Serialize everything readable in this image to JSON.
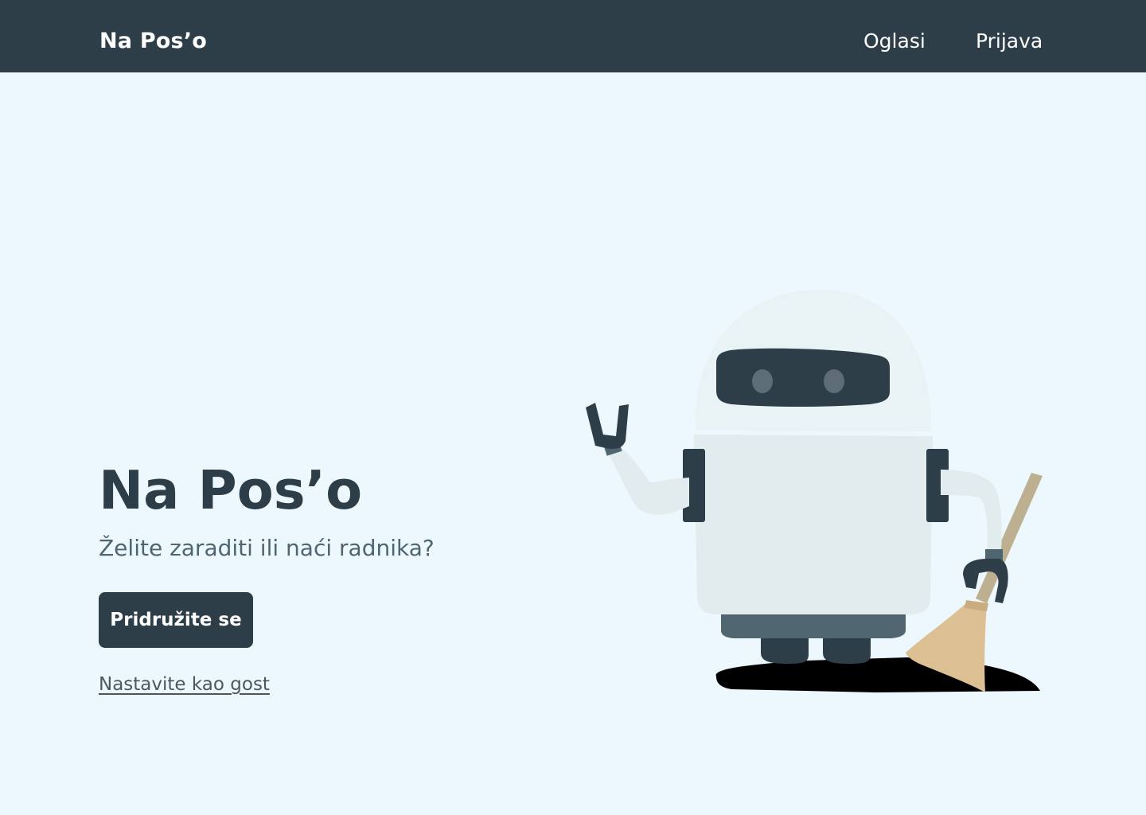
{
  "navbar": {
    "brand": "Na Pos’o",
    "links": [
      {
        "label": "Oglasi"
      },
      {
        "label": "Prijava"
      }
    ]
  },
  "hero": {
    "title": "Na Pos’o",
    "subtitle": "Želite zaraditi ili naći radnika?",
    "join_button": "Pridružite se",
    "guest_link": "Nastavite kao gost"
  },
  "illustration": {
    "subject": "robot holding a broom",
    "colors": {
      "body": "#e2ebed",
      "head": "#e9f2f4",
      "dark": "#2e3e48",
      "accent": "#4f6570",
      "broom_handle": "#bdb091",
      "broom_bristles": "#dcbf93",
      "shadow": "#000000"
    }
  },
  "colors": {
    "background": "#edf8fe",
    "navbar": "#2e3e48",
    "primary": "#2e3e48",
    "subtitle": "#4f6570"
  }
}
